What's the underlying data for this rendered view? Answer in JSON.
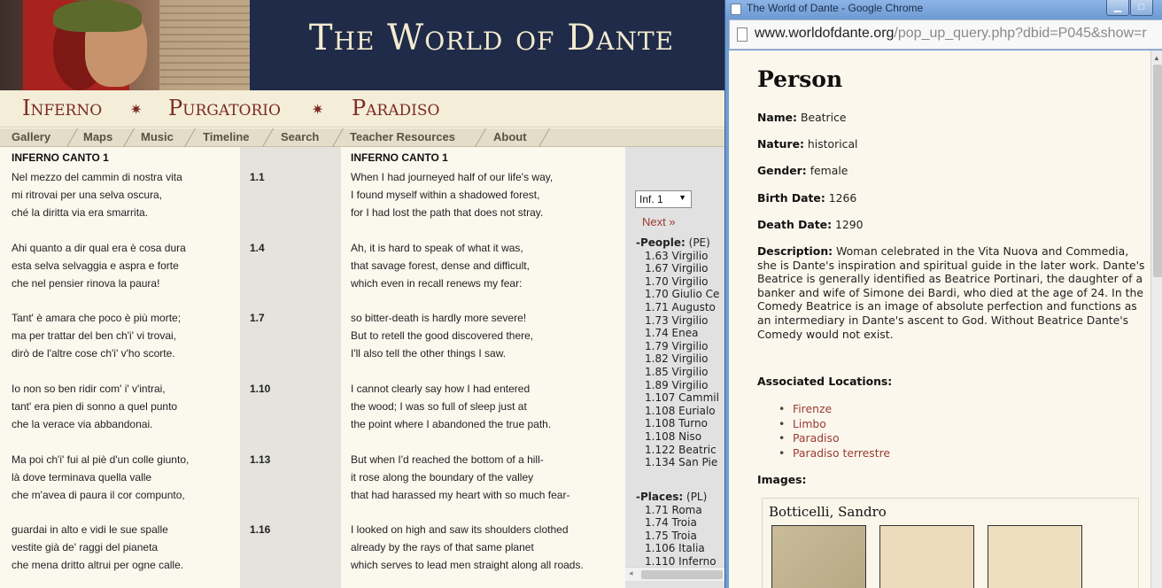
{
  "site": {
    "title": "The World of Dante",
    "realms": [
      "Inferno",
      "Purgatorio",
      "Paradiso"
    ],
    "realm_separator": "✷",
    "nav": [
      "Gallery",
      "Maps",
      "Music",
      "Timeline",
      "Search",
      "Teacher Resources",
      "About"
    ]
  },
  "canto": {
    "italian_heading": "INFERNO CANTO 1",
    "english_heading": "INFERNO CANTO 1",
    "tercets": [
      {
        "num": "1.1",
        "it": [
          "Nel mezzo del cammin di nostra vita",
          "mi ritrovai per una selva oscura,",
          "ché la diritta via era smarrita."
        ],
        "en": [
          "When I had journeyed half of our life's way,",
          "I found myself within a shadowed forest,",
          "for I had lost the path that does not stray."
        ]
      },
      {
        "num": "1.4",
        "it": [
          "Ahi quanto a dir qual era è cosa dura",
          "esta selva selvaggia e aspra e forte",
          "che nel pensier rinova la paura!"
        ],
        "en": [
          "Ah, it is hard to speak of what it was,",
          "that savage forest, dense and difficult,",
          "which even in recall renews my fear:"
        ]
      },
      {
        "num": "1.7",
        "it": [
          "Tant' è amara che poco è più morte;",
          "ma per trattar del ben ch'i' vi trovai,",
          "dirò de l'altre cose ch'i' v'ho scorte."
        ],
        "en": [
          "so bitter-death is hardly more severe!",
          "But to retell the good discovered there,",
          "I'll also tell the other things I saw."
        ]
      },
      {
        "num": "1.10",
        "it": [
          "Io non so ben ridir com' i' v'intrai,",
          "tant' era pien di sonno a quel punto",
          "che la verace via abbandonai."
        ],
        "en": [
          "I cannot clearly say how I had entered",
          "the wood; I was so full of sleep just at",
          "the point where I abandoned the true path."
        ]
      },
      {
        "num": "1.13",
        "it": [
          "Ma poi ch'i' fui al piè d'un colle giunto,",
          "là dove terminava quella valle",
          "che m'avea di paura il cor compunto,"
        ],
        "en": [
          "But when I'd reached the bottom of a hill-",
          "it rose along the boundary of the valley",
          "that had harassed my heart with so much fear-"
        ]
      },
      {
        "num": "1.16",
        "it": [
          "guardai in alto e vidi le sue spalle",
          "vestite già de' raggi del pianeta",
          "che mena dritto altrui per ogne calle."
        ],
        "en": [
          "I looked on high and saw its shoulders clothed",
          "already by the rays of that same planet",
          "which serves to lead men straight along all roads."
        ]
      }
    ]
  },
  "sidebar": {
    "select_value": "Inf. 1",
    "next_label": "Next »",
    "people_label": "-People:",
    "people_code": "(PE)",
    "people": [
      "1.63 Virgilio",
      "1.67 Virgilio",
      "1.70 Virgilio",
      "1.70 Giulio Ce",
      "1.71 Augusto",
      "1.73 Virgilio",
      "1.74 Enea",
      "1.79 Virgilio",
      "1.82 Virgilio",
      "1.85 Virgilio",
      "1.89 Virgilio",
      "1.107 Cammil",
      "1.108 Eurialo",
      "1.108 Turno",
      "1.108 Niso",
      "1.122 Beatric",
      "1.134 San Pie"
    ],
    "places_label": "-Places:",
    "places_code": "(PL)",
    "places": [
      "1.71 Roma",
      "1.74 Troia",
      "1.75 Troia",
      "1.106 Italia",
      "1.110 Inferno"
    ]
  },
  "popup": {
    "window_title": "The World of Dante - Google Chrome",
    "url_domain": "www.worldofdante.org",
    "url_path": "/pop_up_query.php?dbid=P045&show=r",
    "heading": "Person",
    "name_label": "Name:",
    "name": "Beatrice",
    "nature_label": "Nature:",
    "nature": "historical",
    "gender_label": "Gender:",
    "gender": "female",
    "birth_label": "Birth Date:",
    "birth": "1266",
    "death_label": "Death Date:",
    "death": "1290",
    "description_label": "Description:",
    "description": "Woman celebrated in the Vita Nuova and Commedia, she is Dante's inspiration and spiritual guide in the later work. Dante's Beatrice is generally identified as Beatrice Portinari, the daughter of a banker and wife of Simone dei Bardi, who died at the age of 24. In the Comedy Beatrice is an image of absolute perfection and functions as an intermediary in Dante's ascent to God. Without Beatrice Dante's Comedy would not exist.",
    "locations_label": "Associated Locations:",
    "locations": [
      "Firenze",
      "Limbo",
      "Paradiso",
      "Paradiso terrestre"
    ],
    "images_label": "Images:",
    "artist": "Botticelli, Sandro"
  },
  "colors": {
    "banner": "#1f2b48",
    "realm_text": "#7b2a22",
    "link": "#9a3a33",
    "popup_bg": "#fbf7ec"
  }
}
